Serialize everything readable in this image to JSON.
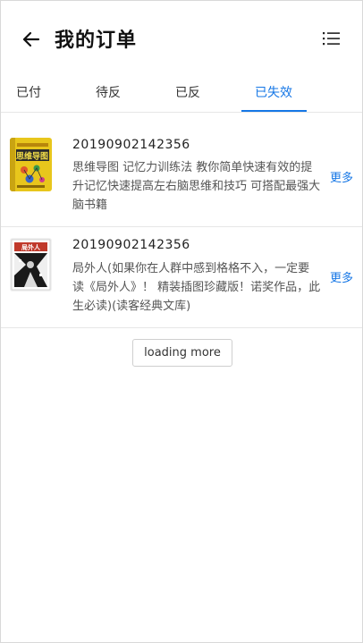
{
  "header": {
    "title": "我的订单",
    "back_icon": "arrow-left-icon",
    "menu_icon": "list-icon"
  },
  "tabs": [
    {
      "label": "已付",
      "active": false
    },
    {
      "label": "待反",
      "active": false
    },
    {
      "label": "已反",
      "active": false
    },
    {
      "label": "已失效",
      "active": true
    }
  ],
  "orders": [
    {
      "order_no": "20190902142356",
      "description": "思维导图 记忆力训练法 教你简单快速有效的提升记忆快速提高左右脑思维和技巧 可搭配最强大脑书籍",
      "more_label": "更多",
      "cover_icon": "mind-map-book-cover",
      "cover_text": "思维导图"
    },
    {
      "order_no": "20190902142356",
      "description": "局外人(如果你在人群中感到格格不入，一定要读《局外人》！ 精装插图珍藏版！诺奖作品，此生必读)(读客经典文库)",
      "more_label": "更多",
      "cover_icon": "the-stranger-book-cover",
      "cover_text": "局外人"
    }
  ],
  "load_more_label": "loading more",
  "colors": {
    "accent": "#1677e6",
    "divider": "#e6e6e6"
  }
}
